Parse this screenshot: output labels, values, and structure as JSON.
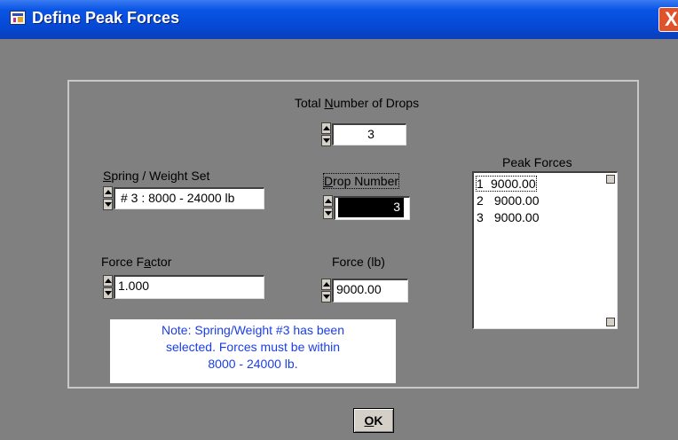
{
  "window": {
    "title": "Define Peak Forces",
    "app_icon": "application-icon",
    "close_icon": "close-icon",
    "close_glyph": "X"
  },
  "drops": {
    "label_prefix": "Total ",
    "label_mnemonic": "N",
    "label_suffix": "umber of Drops",
    "value": "3"
  },
  "spring_weight": {
    "label_mnemonic": "S",
    "label_suffix": "pring / Weight Set",
    "value": "# 3 : 8000 - 24000 lb"
  },
  "drop_number": {
    "label_mnemonic": "D",
    "label_suffix": "rop Number",
    "value": "3"
  },
  "force_factor": {
    "label_prefix": "Force F",
    "label_mnemonic": "a",
    "label_suffix": "ctor",
    "value": "1.000"
  },
  "force": {
    "label": "Force (lb)",
    "value": "9000.00"
  },
  "peak_forces": {
    "label": "Peak Forces",
    "items": [
      {
        "num": "1",
        "value": "9000.00"
      },
      {
        "num": "2",
        "value": "9000.00"
      },
      {
        "num": "3",
        "value": "9000.00"
      }
    ]
  },
  "note": {
    "line1": "Note: Spring/Weight #3 has been",
    "line2": "selected. Forces must be within",
    "line3": "8000 - 24000 lb."
  },
  "ok_button": {
    "mnemonic": "O",
    "rest": "K"
  },
  "colors": {
    "titlebar": "#0548d4",
    "dialog_bg": "#808080",
    "note_text": "#1a3ee8",
    "close_button": "#e0522a"
  }
}
